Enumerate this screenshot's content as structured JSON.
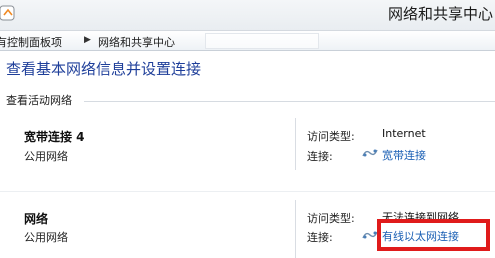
{
  "window": {
    "title": "网络和共享中心"
  },
  "breadcrumb": {
    "items": [
      "所有控制面板项",
      "网络和共享中心"
    ],
    "root_visible": "有控制面板项"
  },
  "page": {
    "heading": "查看基本网络信息并设置连接",
    "section_label": "查看活动网络"
  },
  "networks": [
    {
      "name": "宽带连接 4",
      "category": "公用网络",
      "access_type_label": "访问类型:",
      "access_type_value": "Internet",
      "connection_label": "连接:",
      "connection_value": "宽带连接"
    },
    {
      "name": "网络",
      "category": "公用网络",
      "access_type_label": "访问类型:",
      "access_type_value": "无法连接到网络",
      "connection_label": "连接:",
      "connection_value": "有线以太网连接"
    }
  ],
  "colors": {
    "heading": "#1f3f9a",
    "link": "#1a5fb4",
    "highlight": "#e01b1b"
  },
  "icons": {
    "app": "network-app-icon",
    "connection": "network-connection-icon"
  }
}
